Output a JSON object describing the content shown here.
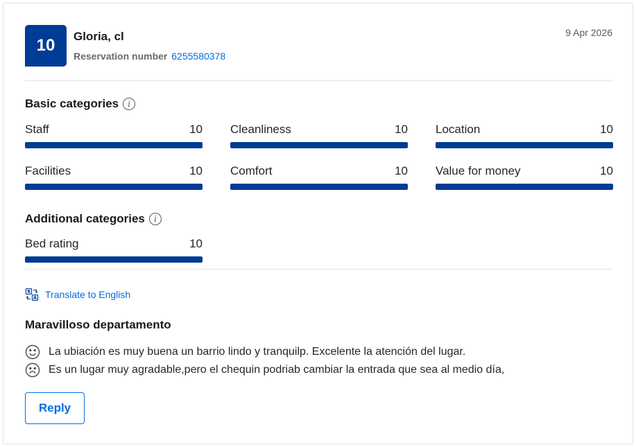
{
  "review": {
    "score": "10",
    "guest_name": "Gloria, cl",
    "reservation_label": "Reservation number",
    "reservation_number": "6255580378",
    "date": "9 Apr 2026"
  },
  "basic": {
    "title": "Basic categories",
    "items": [
      {
        "label": "Staff",
        "score": "10",
        "fraction": 1.0
      },
      {
        "label": "Cleanliness",
        "score": "10",
        "fraction": 1.0
      },
      {
        "label": "Location",
        "score": "10",
        "fraction": 1.0
      },
      {
        "label": "Facilities",
        "score": "10",
        "fraction": 1.0
      },
      {
        "label": "Comfort",
        "score": "10",
        "fraction": 1.0
      },
      {
        "label": "Value for money",
        "score": "10",
        "fraction": 1.0
      }
    ]
  },
  "additional": {
    "title": "Additional categories",
    "items": [
      {
        "label": "Bed rating",
        "score": "10",
        "fraction": 1.0
      }
    ]
  },
  "translate_label": "Translate to English",
  "content": {
    "title": "Maravilloso departamento",
    "positive": "La ubiación es muy buena un barrio lindo y tranquilp. Excelente la atención del lugar.",
    "negative": "Es un lugar muy agradable,pero el chequin podriab cambiar la entrada que sea al medio día,"
  },
  "reply_label": "Reply",
  "colors": {
    "brand_blue": "#003b95",
    "link_blue": "#006ce4"
  }
}
